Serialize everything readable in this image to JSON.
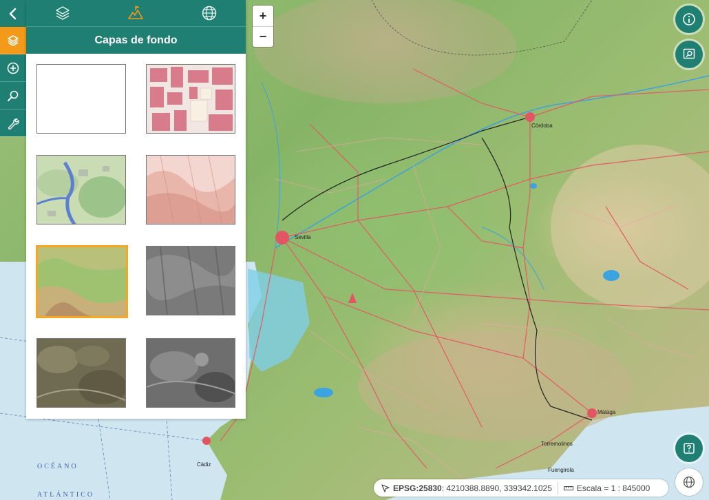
{
  "iconbar": {
    "items": [
      {
        "icon": "chevron-left-icon"
      },
      {
        "icon": "layers-icon",
        "active": true
      },
      {
        "icon": "add-circle-icon"
      },
      {
        "icon": "search-icon"
      },
      {
        "icon": "wrench-icon"
      }
    ]
  },
  "panel": {
    "tabs": [
      {
        "icon": "layers-icon"
      },
      {
        "icon": "map-icon",
        "active": true
      },
      {
        "icon": "globe-icon"
      }
    ],
    "title": "Capas de fondo",
    "thumbnails": [
      {
        "kind": "blank"
      },
      {
        "kind": "cadastral"
      },
      {
        "kind": "land-use"
      },
      {
        "kind": "relief-red"
      },
      {
        "kind": "topographic",
        "selected": true
      },
      {
        "kind": "hillshade-gray"
      },
      {
        "kind": "orthophoto-color"
      },
      {
        "kind": "orthophoto-bw"
      }
    ]
  },
  "zoom": {
    "in": "+",
    "out": "−"
  },
  "right_buttons": [
    {
      "icon": "info-icon"
    },
    {
      "icon": "map-search-icon"
    },
    {
      "icon": "help-icon"
    },
    {
      "icon": "globe-icon"
    }
  ],
  "status": {
    "epsg_label": "EPSG:25830",
    "coordinates": ": 4210388.8890, 339342.1025",
    "scale": "Escala = 1 : 845000"
  },
  "map_labels": {
    "ocean1": "OCÉANO",
    "ocean2": "ATLÁNTICO",
    "cordoba": "Córdoba",
    "cadiz": "Cádiz",
    "malaga": "Málaga",
    "sevilla": "Sevilla",
    "torremolinos": "Torremolinos",
    "fuengirola": "Fuengirola"
  },
  "colors": {
    "teal": "#1f7f72",
    "orange": "#f39a1a",
    "selected_border": "#f5a623"
  }
}
